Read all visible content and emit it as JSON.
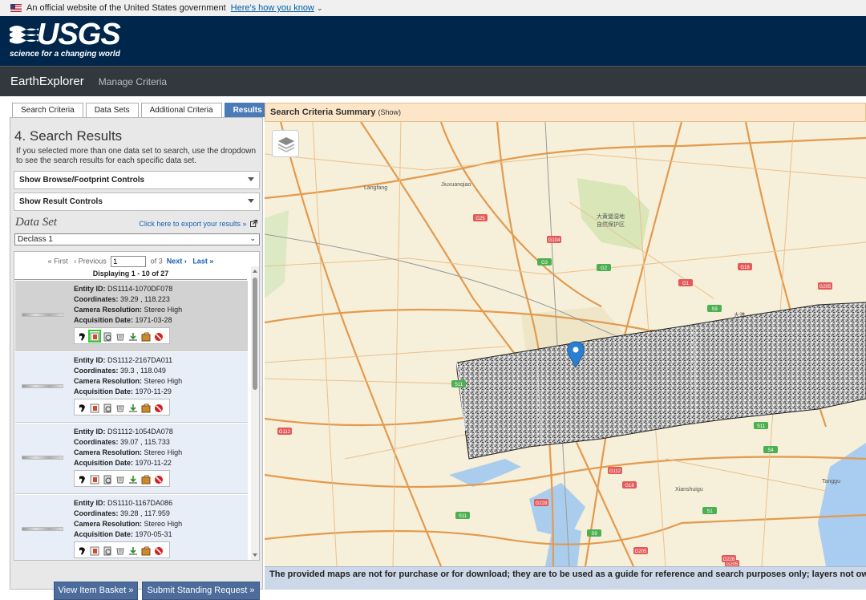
{
  "gov_banner": {
    "text": "An official website of the United States government",
    "link": "Here's how you know"
  },
  "usgs": {
    "logo_text": "USGS",
    "tagline": "science for a changing world"
  },
  "app_bar": {
    "title": "EarthExplorer",
    "manage_link": "Manage Criteria"
  },
  "tabs": [
    {
      "label": "Search Criteria",
      "active": false
    },
    {
      "label": "Data Sets",
      "active": false
    },
    {
      "label": "Additional Criteria",
      "active": false
    },
    {
      "label": "Results",
      "active": true
    }
  ],
  "results_panel": {
    "title": "4. Search Results",
    "description": "If you selected more than one data set to search, use the dropdown to see the search results for each specific data set.",
    "browse_controls": "Show Browse/Footprint Controls",
    "result_controls": "Show Result Controls",
    "dataset_label": "Data Set",
    "export_link": "Click here to export your results »",
    "dataset_selected": "Declass 1"
  },
  "pager": {
    "first": "« First",
    "previous": "‹ Previous",
    "page_value": "1",
    "of_text": "of 3",
    "next": "Next ›",
    "last": "Last »",
    "displaying": "Displaying 1 - 10 of 27"
  },
  "results": [
    {
      "entity_label": "Entity ID:",
      "entity": "DS1114-1070DF078",
      "coord_label": "Coordinates:",
      "coords": "39.29 , 118.223",
      "cam_label": "Camera Resolution:",
      "camera": "Stereo High",
      "acq_label": "Acquisition Date:",
      "date": "1971-03-28",
      "selected": true
    },
    {
      "entity_label": "Entity ID:",
      "entity": "DS1112-2167DA011",
      "coord_label": "Coordinates:",
      "coords": "39.3 , 118.049",
      "cam_label": "Camera Resolution:",
      "camera": "Stereo High",
      "acq_label": "Acquisition Date:",
      "date": "1970-11-29",
      "selected": false
    },
    {
      "entity_label": "Entity ID:",
      "entity": "DS1112-1054DA078",
      "coord_label": "Coordinates:",
      "coords": "39.07 , 115.733",
      "cam_label": "Camera Resolution:",
      "camera": "Stereo High",
      "acq_label": "Acquisition Date:",
      "date": "1970-11-22",
      "selected": false
    },
    {
      "entity_label": "Entity ID:",
      "entity": "DS1110-1167DA086",
      "coord_label": "Coordinates:",
      "coords": "39.28 , 117.959",
      "cam_label": "Camera Resolution:",
      "camera": "Stereo High",
      "acq_label": "Acquisition Date:",
      "date": "1970-05-31",
      "selected": false
    }
  ],
  "buttons": {
    "basket": "View Item Basket »",
    "standing": "Submit Standing Request »"
  },
  "map": {
    "summary_title": "Search Criteria Summary",
    "summary_show": "(Show)",
    "place_labels": [
      "Langfang",
      "Jiuxuanqiao",
      "大黄堡湿地",
      "自然保护区",
      "大港",
      "Xianshuigu",
      "Tanggu"
    ],
    "road_labels": [
      "G3",
      "G2",
      "G1",
      "S9",
      "G18",
      "G25",
      "G104",
      "S11",
      "G112",
      "G228",
      "G112",
      "S1",
      "G18",
      "S4",
      "G205",
      "S11",
      "G205",
      "S9",
      "G205",
      "S11",
      "G228"
    ],
    "footer_note": "The provided maps are not for purchase or for download; they are to be used as a guide for reference and search purposes only; layers not own"
  },
  "colors": {
    "header_navy": "#00264c",
    "app_bar": "#32383d",
    "tab_active": "#4a7ab8",
    "button_blue": "#4c6c9c",
    "summary_bar": "#fde6c8",
    "map_marker": "#2a7fd0"
  }
}
